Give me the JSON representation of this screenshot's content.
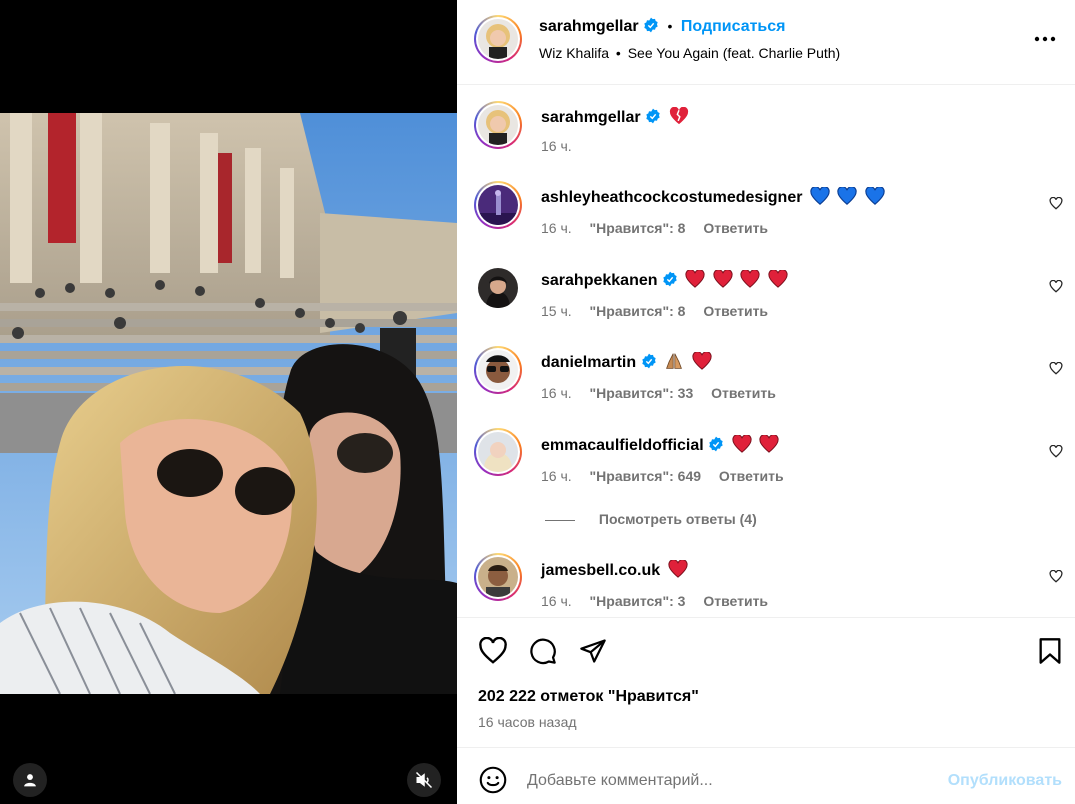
{
  "header": {
    "username": "sarahmgellar",
    "follow_label": "Подписаться",
    "separator": "•",
    "audio_artist": "Wiz Khalifa",
    "audio_track": "See You Again (feat. Charlie Puth)",
    "more_icon": "more-horizontal-icon"
  },
  "caption": {
    "username": "sarahmgellar",
    "emojis": [
      "broken-heart"
    ],
    "time": "16 ч."
  },
  "comments": [
    {
      "username": "ashleyheathcockcostumedesigner",
      "verified": false,
      "emojis": [
        "blue-heart",
        "blue-heart",
        "blue-heart"
      ],
      "time": "16 ч.",
      "likes": "\"Нравится\": 8",
      "reply": "Ответить"
    },
    {
      "username": "sarahpekkanen",
      "verified": true,
      "emojis": [
        "red-heart",
        "red-heart",
        "red-heart",
        "red-heart"
      ],
      "time": "15 ч.",
      "likes": "\"Нравится\": 8",
      "reply": "Ответить"
    },
    {
      "username": "danielmartin",
      "verified": true,
      "emojis": [
        "folded-hands",
        "red-heart"
      ],
      "time": "16 ч.",
      "likes": "\"Нравится\": 33",
      "reply": "Ответить"
    },
    {
      "username": "emmacaulfieldofficial",
      "verified": true,
      "emojis": [
        "red-heart",
        "red-heart"
      ],
      "time": "16 ч.",
      "likes": "\"Нравится\": 649",
      "reply": "Ответить"
    },
    {
      "username": "jamesbell.co.uk",
      "verified": false,
      "emojis": [
        "red-heart"
      ],
      "time": "16 ч.",
      "likes": "\"Нравится\": 3",
      "reply": "Ответить"
    }
  ],
  "view_replies": "Посмотреть ответы (4)",
  "likes_count": "202 222 отметок \"Нравится\"",
  "post_time": "16 часов назад",
  "comment_box": {
    "placeholder": "Добавьте комментарий...",
    "publish_label": "Опубликовать"
  },
  "colors": {
    "accent": "#0095f6",
    "publish_disabled": "#b2dffc",
    "verified": "#0095f6",
    "muted_text": "#737373"
  }
}
